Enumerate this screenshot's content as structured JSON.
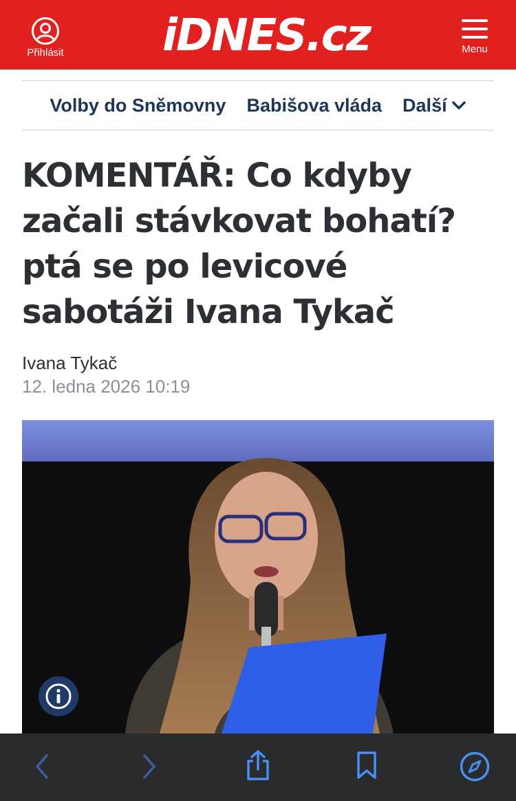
{
  "header": {
    "login_label": "Přihlásit",
    "logo_text": "iDNES.cz",
    "menu_label": "Menu",
    "background": "#e1211f"
  },
  "nav": {
    "items": [
      {
        "label": "Volby do Sněmovny"
      },
      {
        "label": "Babišova vláda"
      },
      {
        "label": "Další"
      }
    ],
    "color": "#1d3557"
  },
  "article": {
    "title": "KOMENTÁŘ: Co kdyby začali stávkovat bohatí? ptá se po levicové sabotáži Ivana Tykač",
    "author": "Ivana Tykač",
    "date": "12. ledna 2026  10:19"
  },
  "photo": {
    "info_icon": "info-icon"
  },
  "browser_toolbar": {
    "icons": [
      "back-icon",
      "forward-icon",
      "share-icon",
      "bookmarks-icon",
      "compass-icon"
    ],
    "accent": "#4a8ef0"
  }
}
